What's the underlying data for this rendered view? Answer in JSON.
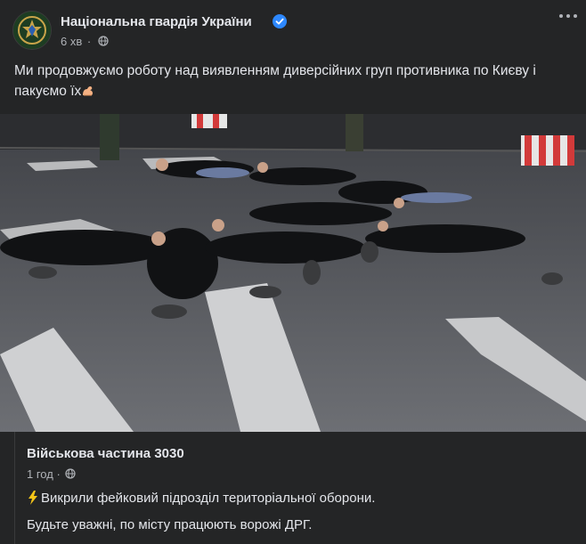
{
  "post": {
    "author": "Національна гвардія України",
    "time": "6 хв",
    "text": "Ми продовжуємо роботу над виявленням диверсійних груп противника по Києву і пакуємо їх",
    "emoji": "flexed-biceps-emoji",
    "icons": {
      "verified": "verified-badge-icon",
      "audience": "globe-icon",
      "more": "more-options-icon"
    }
  },
  "shared": {
    "author": "Військова частина 3030",
    "time": "1 год",
    "line1": "Викрили фейковий підрозділ територіальної оборони.",
    "line2": "Будьте уважні, по місту працюють ворожі ДРГ.",
    "icons": {
      "bolt": "high-voltage-emoji",
      "audience": "globe-icon"
    }
  },
  "colors": {
    "background": "#242526",
    "text": "#e4e6eb",
    "secondary_text": "#b0b3b8",
    "verified": "#2d88ff",
    "bolt": "#f5c518"
  }
}
